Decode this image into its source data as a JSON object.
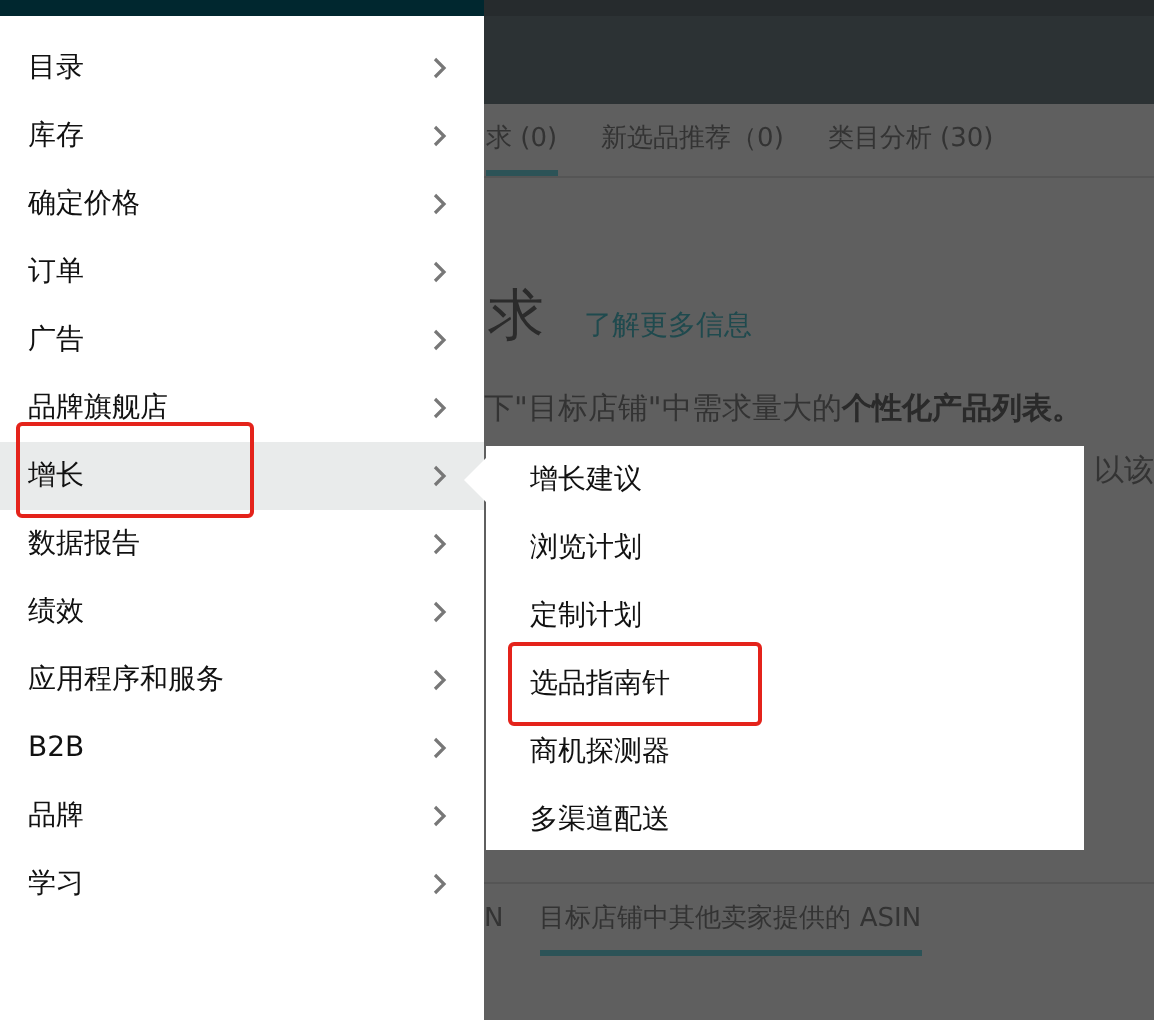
{
  "menu": {
    "items": [
      {
        "label": "目录",
        "selected": false,
        "highlighted": false
      },
      {
        "label": "库存",
        "selected": false,
        "highlighted": false
      },
      {
        "label": "确定价格",
        "selected": false,
        "highlighted": false
      },
      {
        "label": "订单",
        "selected": false,
        "highlighted": false
      },
      {
        "label": "广告",
        "selected": false,
        "highlighted": false
      },
      {
        "label": "品牌旗舰店",
        "selected": false,
        "highlighted": false
      },
      {
        "label": "增长",
        "selected": true,
        "highlighted": true
      },
      {
        "label": "数据报告",
        "selected": false,
        "highlighted": false
      },
      {
        "label": "绩效",
        "selected": false,
        "highlighted": false
      },
      {
        "label": "应用程序和服务",
        "selected": false,
        "highlighted": false
      },
      {
        "label": "B2B",
        "selected": false,
        "highlighted": false
      },
      {
        "label": "品牌",
        "selected": false,
        "highlighted": false
      },
      {
        "label": "学习",
        "selected": false,
        "highlighted": false
      }
    ]
  },
  "submenu": {
    "items": [
      {
        "label": "增长建议",
        "highlighted": false
      },
      {
        "label": "浏览计划",
        "highlighted": false
      },
      {
        "label": "定制计划",
        "highlighted": false
      },
      {
        "label": "选品指南针",
        "highlighted": true
      },
      {
        "label": "商机探测器",
        "highlighted": false
      },
      {
        "label": "多渠道配送",
        "highlighted": false
      }
    ]
  },
  "background": {
    "tabs": [
      {
        "label": "求 (0)",
        "selected": true
      },
      {
        "label": "新选品推荐（0)",
        "selected": false
      },
      {
        "label": "类目分析 (30)",
        "selected": false
      }
    ],
    "heading": "求",
    "link": "了解更多信息",
    "description": "下\"目标店铺\"中需求量大的**个性化产品列表。**",
    "description_tail": "以该",
    "lower_tabs": [
      {
        "label": "N",
        "selected": false
      },
      {
        "label": "目标店铺中其他卖家提供的 ASIN",
        "selected": true
      }
    ]
  }
}
